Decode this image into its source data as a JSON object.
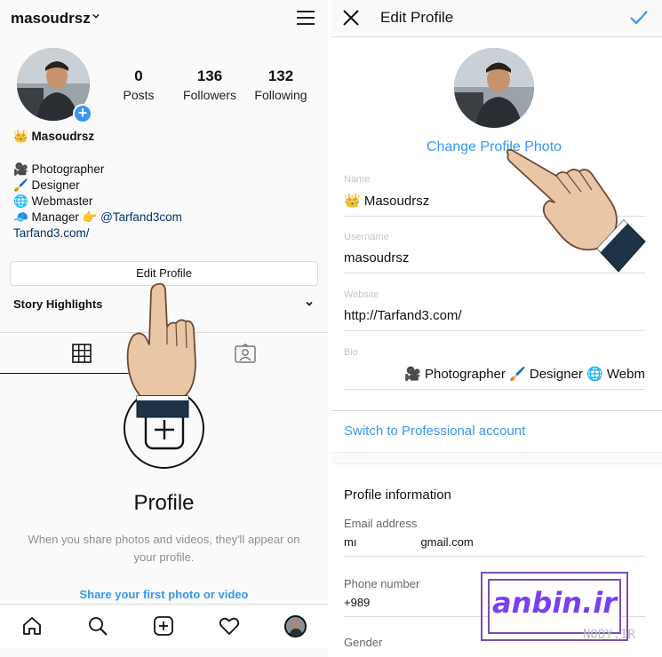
{
  "left": {
    "username": "masoudrsz",
    "stats": [
      {
        "value": "0",
        "label": "Posts"
      },
      {
        "value": "136",
        "label": "Followers"
      },
      {
        "value": "132",
        "label": "Following"
      }
    ],
    "display_name": "👑 Masoudrsz",
    "bio_lines": [
      "🎥 Photographer",
      "🖌️ Designer",
      "🌐 Webmaster",
      "🧢 Manager 👉 "
    ],
    "bio_mention": "@Tarfand3com",
    "bio_link": "Tarfand3.com/",
    "edit_profile_label": "Edit Profile",
    "story_highlights_label": "Story Highlights",
    "empty_title": "Profile",
    "empty_desc": "When you share photos and videos, they'll appear on your profile.",
    "share_link": "Share your first photo or video"
  },
  "right": {
    "title": "Edit Profile",
    "change_photo": "Change Profile Photo",
    "fields": {
      "name": {
        "label": "Name",
        "value": "👑 Masoudrsz"
      },
      "username": {
        "label": "Username",
        "value": "masoudrsz"
      },
      "website": {
        "label": "Website",
        "value": "http://Tarfand3.com/"
      },
      "bio": {
        "label": "Bio",
        "value": "🎥 Photographer 🖌️ Designer 🌐 Webm"
      }
    },
    "switch_pro": "Switch to Professional account",
    "profile_info_title": "Profile information",
    "email": {
      "label": "Email address",
      "value_start": "mı",
      "value_end": "gmail.com"
    },
    "phone": {
      "label": "Phone number",
      "value": "+989"
    },
    "gender": {
      "label": "Gender"
    }
  },
  "watermark": {
    "text": "anbin.ir",
    "nody": "NODY.IR"
  },
  "colors": {
    "accent": "#3897f0",
    "link_dark": "#003569",
    "watermark": "#7a3ff0"
  }
}
